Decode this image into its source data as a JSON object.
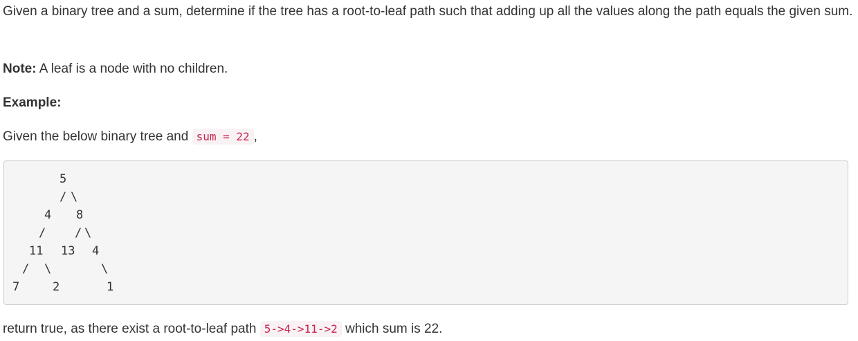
{
  "paragraph1": "Given a binary tree and a sum, determine if the tree has a root-to-leaf path such that adding up all the values along the path equals the given sum.",
  "note": {
    "label": "Note:",
    "text": " A leaf is a node with no children."
  },
  "example_heading": "Example:",
  "given": {
    "prefix": "Given the below binary tree and ",
    "code": "sum = 22",
    "suffix": ","
  },
  "tree": {
    "root": "5",
    "level1_left": "4",
    "level1_right": "8",
    "level2_a": "11",
    "level2_b": "13",
    "level2_c": "4",
    "level3_a": "7",
    "level3_b": "2",
    "level3_c": "1",
    "slash": "/",
    "backslash": "\\"
  },
  "result": {
    "prefix": "return true, as there exist a root-to-leaf path ",
    "code": "5->4->11->2",
    "suffix": " which sum is 22."
  }
}
